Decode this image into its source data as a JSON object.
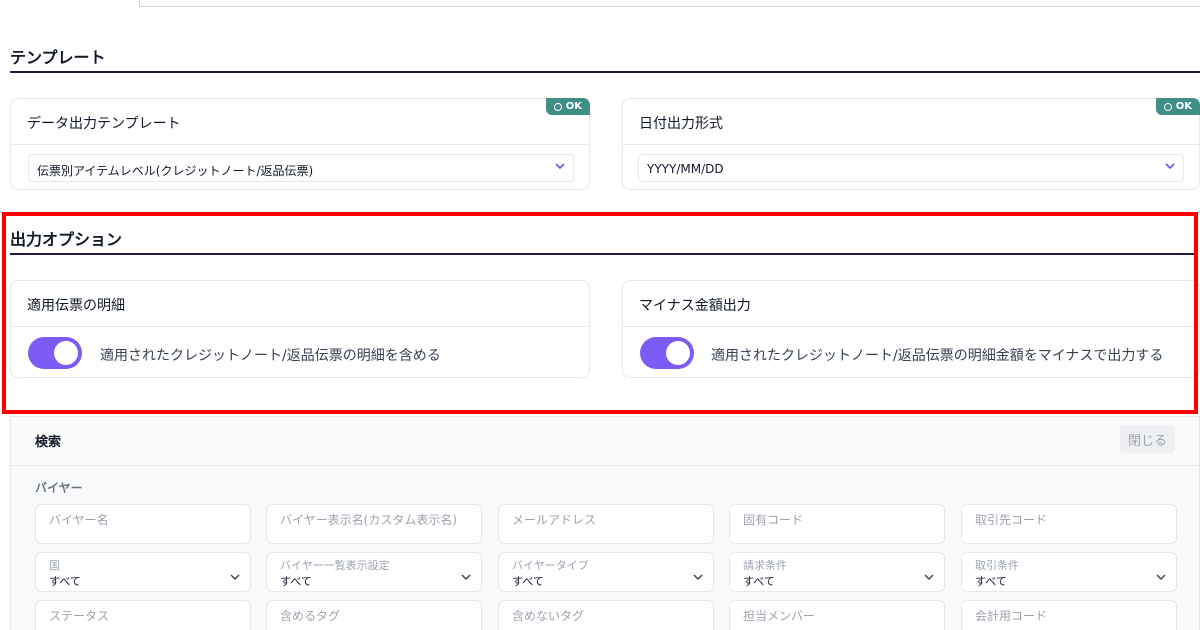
{
  "template_section": {
    "title": "テンプレート",
    "data_template": {
      "label": "データ出力テンプレート",
      "badge": "OK",
      "value": "伝票別アイテムレベル(クレジットノート/返品伝票)"
    },
    "date_format": {
      "label": "日付出力形式",
      "badge": "OK",
      "value": "YYYY/MM/DD"
    }
  },
  "output_options": {
    "title": "出力オプション",
    "applied_details": {
      "label": "適用伝票の明細",
      "toggle_on": true,
      "description": "適用されたクレジットノート/返品伝票の明細を含める"
    },
    "minus_amount": {
      "label": "マイナス金額出力",
      "toggle_on": true,
      "description": "適用されたクレジットノート/返品伝票の明細金額をマイナスで出力する"
    }
  },
  "search": {
    "title": "検索",
    "close_label": "閉じる",
    "group_label": "バイヤー",
    "row1": [
      "バイヤー名",
      "バイヤー表示名(カスタム表示名)",
      "メールアドレス",
      "固有コード",
      "取引先コード"
    ],
    "row2": [
      {
        "label": "国",
        "value": "すべて"
      },
      {
        "label": "バイヤー一覧表示設定",
        "value": "すべて"
      },
      {
        "label": "バイヤータイプ",
        "value": "すべて"
      },
      {
        "label": "請求条件",
        "value": "すべて"
      },
      {
        "label": "取引条件",
        "value": "すべて"
      }
    ],
    "row3": [
      "ステータス",
      "含めるタグ",
      "含めないタグ",
      "担当メンバー",
      "会計用コード"
    ]
  },
  "colors": {
    "accent": "#7c5cf5",
    "ok_badge": "#3f8f86",
    "highlight": "#ff0000",
    "section_rule": "#1e1b4b"
  }
}
